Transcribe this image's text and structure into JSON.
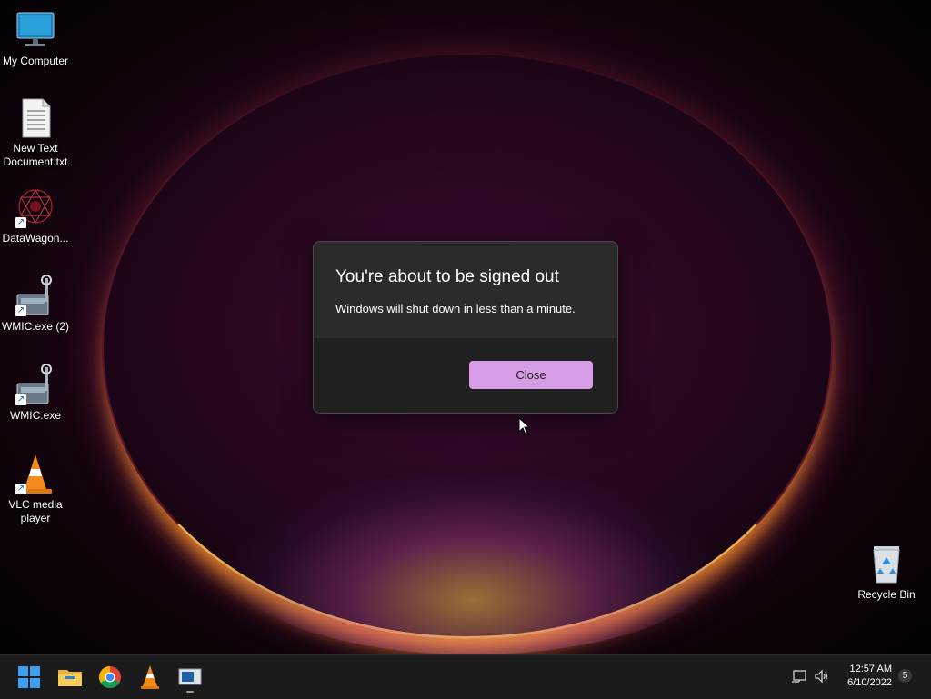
{
  "desktop": {
    "icons": [
      {
        "label": "My Computer",
        "icon": "monitor-icon"
      },
      {
        "label": "New Text Document.txt",
        "icon": "text-file-icon"
      },
      {
        "label": "DataWagon...",
        "icon": "datawagon-app-icon"
      },
      {
        "label": "WMIC.exe (2)",
        "icon": "wmic-app-icon"
      },
      {
        "label": "WMIC.exe",
        "icon": "wmic-app-icon"
      },
      {
        "label": "VLC media player",
        "icon": "vlc-cone-icon"
      },
      {
        "label": "Recycle Bin",
        "icon": "recycle-bin-icon"
      }
    ]
  },
  "dialog": {
    "title": "You're about to be signed out",
    "message": "Windows will shut down in less than a minute.",
    "close_label": "Close",
    "accent_color": "#d79de6"
  },
  "taskbar": {
    "items": [
      {
        "icon": "windows-start-icon"
      },
      {
        "icon": "file-explorer-icon"
      },
      {
        "icon": "chrome-icon"
      },
      {
        "icon": "vlc-icon"
      },
      {
        "icon": "app-window-icon"
      }
    ],
    "tray": {
      "time": "12:57 AM",
      "date": "6/10/2022",
      "notification_count": "5"
    }
  }
}
